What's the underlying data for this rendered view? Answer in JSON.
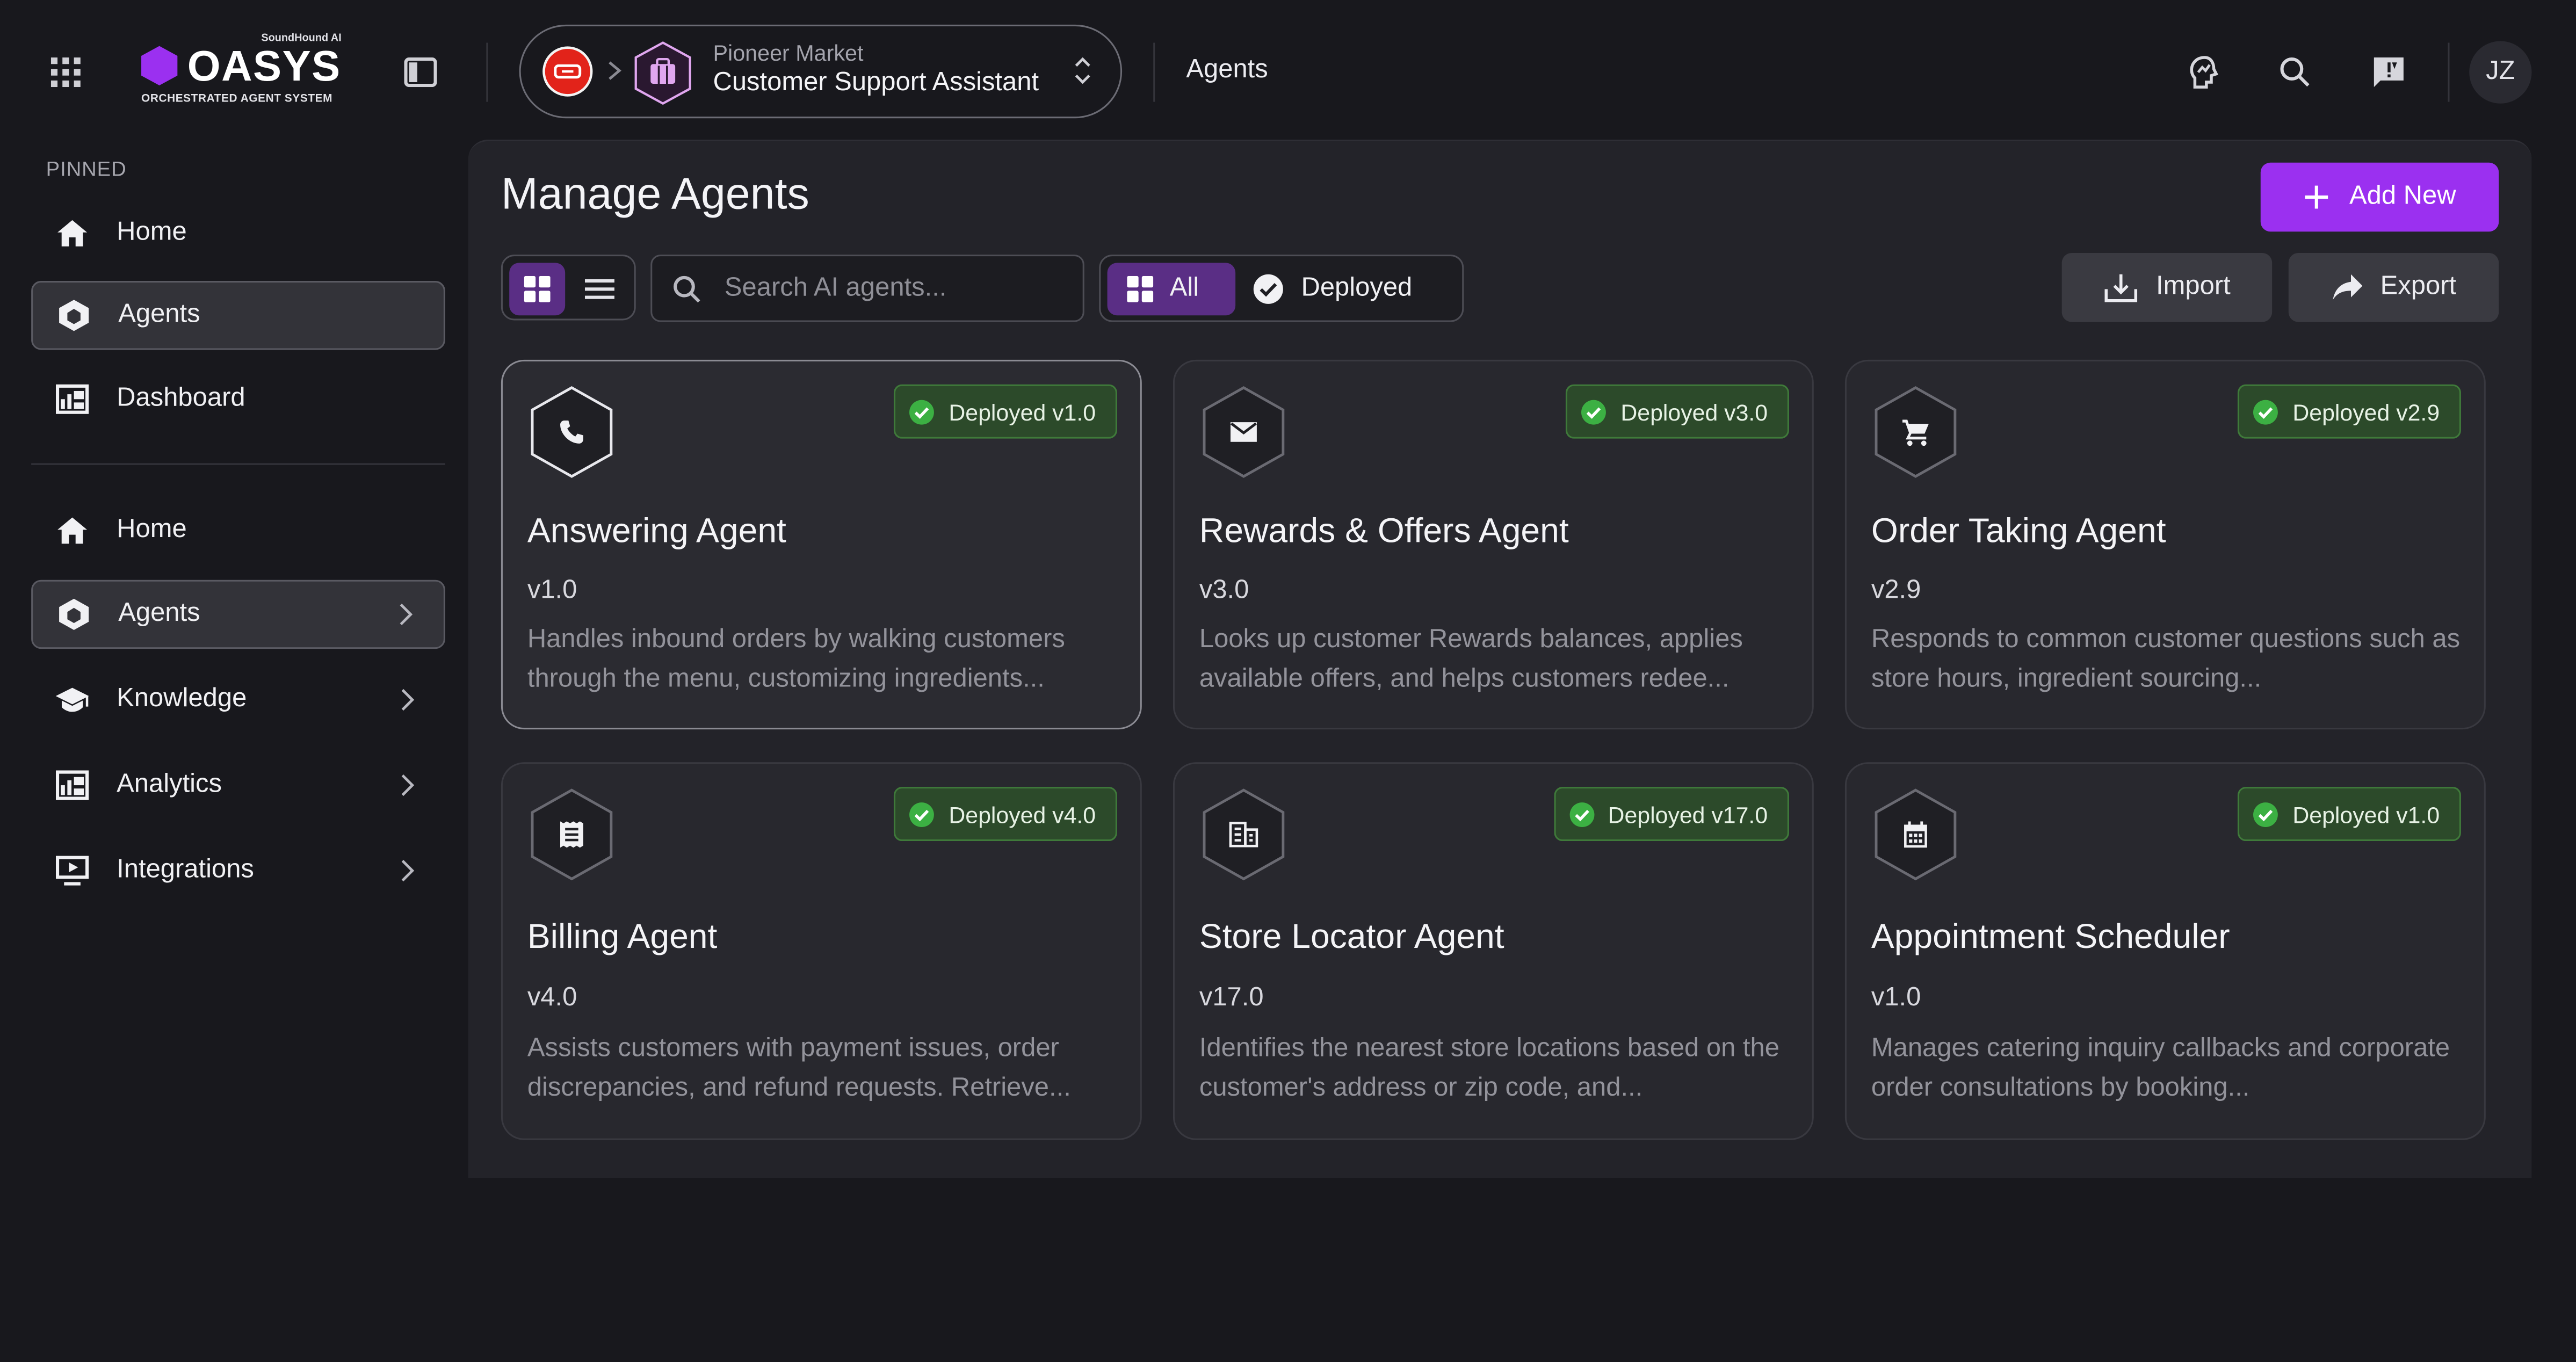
{
  "brand": {
    "name": "OASYS",
    "tagline": "ORCHESTRATED AGENT SYSTEM",
    "maker": "SoundHound AI",
    "accent": "#9b30f0"
  },
  "topbar": {
    "project": "Pioneer Market",
    "assistant": "Customer Support Assistant",
    "current_page": "Agents",
    "user_initials": "JZ",
    "icons": [
      "apps-grid-icon",
      "sidebar-toggle-icon",
      "insights-icon",
      "search-icon",
      "feedback-icon"
    ]
  },
  "sidebar": {
    "pinned_label": "PINNED",
    "pinned": [
      {
        "label": "Home",
        "icon": "home-icon"
      },
      {
        "label": "Agents",
        "icon": "agents-icon",
        "active": true
      },
      {
        "label": "Dashboard",
        "icon": "dashboard-icon"
      }
    ],
    "items": [
      {
        "label": "Home",
        "icon": "home-icon"
      },
      {
        "label": "Agents",
        "icon": "agents-icon",
        "active": true,
        "expandable": true
      },
      {
        "label": "Knowledge",
        "icon": "knowledge-icon",
        "expandable": true
      },
      {
        "label": "Analytics",
        "icon": "analytics-icon",
        "expandable": true
      },
      {
        "label": "Integrations",
        "icon": "integrations-icon",
        "expandable": true
      }
    ]
  },
  "main": {
    "title": "Manage Agents",
    "add_new_label": "Add New",
    "search_placeholder": "Search AI agents...",
    "filters": {
      "all_label": "All",
      "deployed_label": "Deployed",
      "selected": "All"
    },
    "view_mode": "grid",
    "import_label": "Import",
    "export_label": "Export",
    "agents": [
      {
        "name": "Answering Agent",
        "version": "v1.0",
        "status": "Deployed v1.0",
        "icon": "phone-icon",
        "description": "Handles inbound orders by walking customers through the menu, customizing ingredients...",
        "selected": true
      },
      {
        "name": "Rewards & Offers Agent",
        "version": "v3.0",
        "status": "Deployed v3.0",
        "icon": "mail-icon",
        "description": "Looks up customer Rewards balances, applies available offers, and helps customers redee..."
      },
      {
        "name": "Order Taking Agent",
        "version": "v2.9",
        "status": "Deployed v2.9",
        "icon": "cart-icon",
        "description": "Responds to common customer questions such as store hours, ingredient sourcing..."
      },
      {
        "name": "Billing Agent",
        "version": "v4.0",
        "status": "Deployed v4.0",
        "icon": "receipt-icon",
        "description": "Assists customers with payment issues, order discrepancies, and refund requests. Retrieve..."
      },
      {
        "name": "Store Locator Agent",
        "version": "v17.0",
        "status": "Deployed v17.0",
        "icon": "building-icon",
        "description": "Identifies the nearest store locations based on the customer's address or zip code, and..."
      },
      {
        "name": "Appointment Scheduler",
        "version": "v1.0",
        "status": "Deployed v1.0",
        "icon": "calendar-icon",
        "description": "Manages catering inquiry callbacks and corporate order consultations by booking..."
      }
    ]
  },
  "colors": {
    "status_ok": "#3cb043",
    "badge_bg": "#2c4a2a",
    "background": "#18181d",
    "panel": "#232329"
  }
}
